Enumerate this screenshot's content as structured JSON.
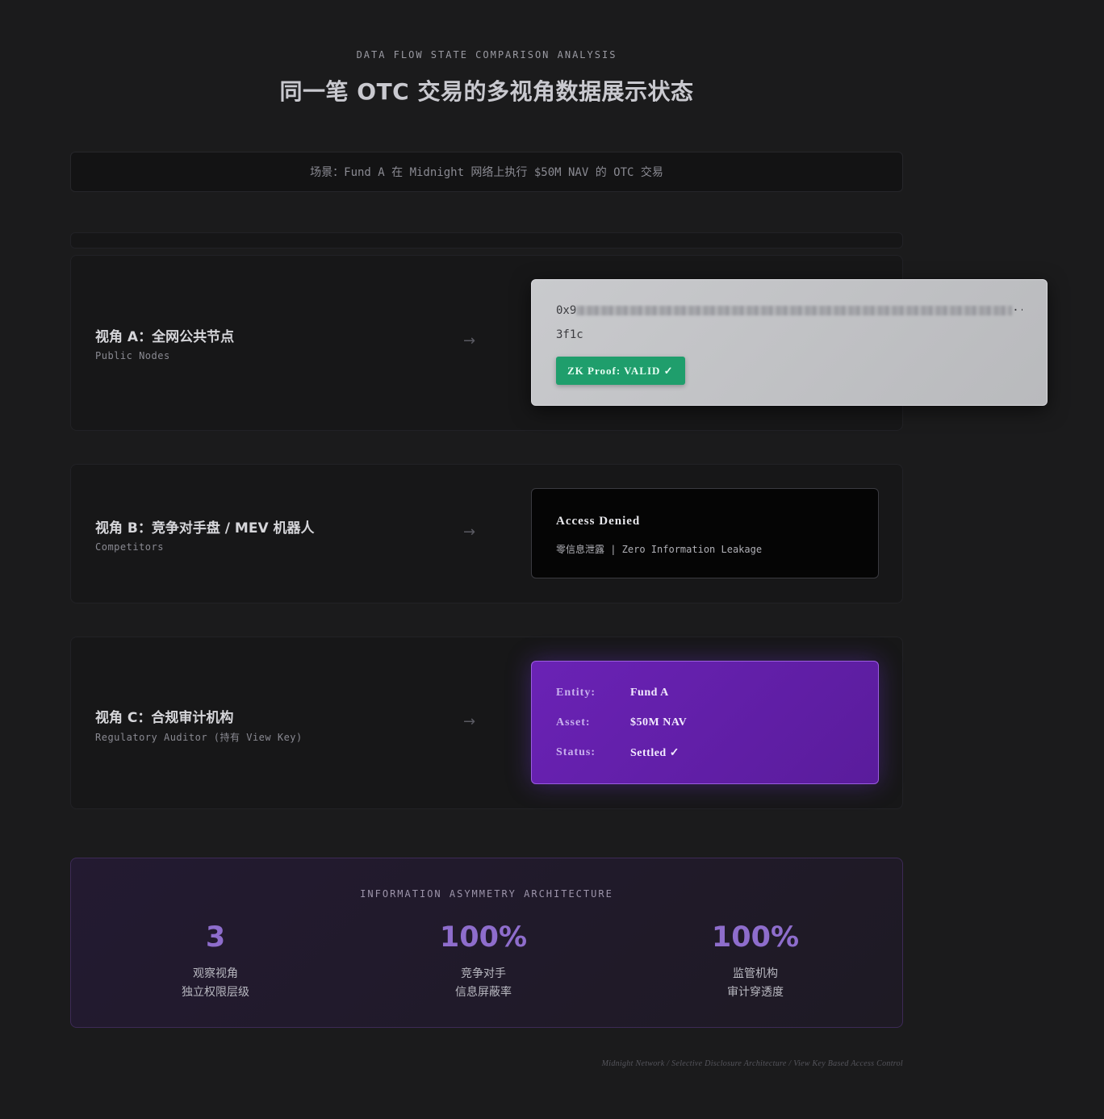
{
  "header": {
    "eyebrow": "DATA FLOW STATE COMPARISON ANALYSIS",
    "title": "同一笔 OTC 交易的多视角数据展示状态"
  },
  "scenario": "场景：Fund A 在 Midnight 网络上执行 $50M NAV 的 OTC 交易",
  "views": [
    {
      "title": "视角 A：全网公共节点",
      "subtitle": "Public Nodes",
      "arrow": "→",
      "hash_prefix": "0x9",
      "hash_ellipsis": "··",
      "hash_end": "3f1c",
      "badge": "ZK Proof: VALID ✓"
    },
    {
      "title": "视角 B：竞争对手盘 / MEV 机器人",
      "subtitle": "Competitors",
      "arrow": "→",
      "denied": "Access Denied",
      "denied_sub": "零信息泄露 | Zero Information Leakage"
    },
    {
      "title": "视角 C：合规审计机构",
      "subtitle": "Regulatory Auditor (持有 View Key)",
      "arrow": "→",
      "fields": [
        {
          "label": "Entity:",
          "value": "Fund A"
        },
        {
          "label": "Asset:",
          "value": "$50M NAV"
        },
        {
          "label": "Status:",
          "value": "Settled ✓"
        }
      ]
    }
  ],
  "summary": {
    "title": "INFORMATION ASYMMETRY ARCHITECTURE",
    "stats": [
      {
        "value": "3",
        "line1": "观察视角",
        "line2": "独立权限层级"
      },
      {
        "value": "100%",
        "line1": "竞争对手",
        "line2": "信息屏蔽率"
      },
      {
        "value": "100%",
        "line1": "监管机构",
        "line2": "审计穿透度"
      }
    ]
  },
  "footer": "Midnight Network / Selective Disclosure Architecture / View Key Based Access Control",
  "colors": {
    "background": "#1b1b1c",
    "valid_badge": "#1f9e6c",
    "auditor_panel": "#6a22b5",
    "stat_accent": "#8e6dcc"
  }
}
